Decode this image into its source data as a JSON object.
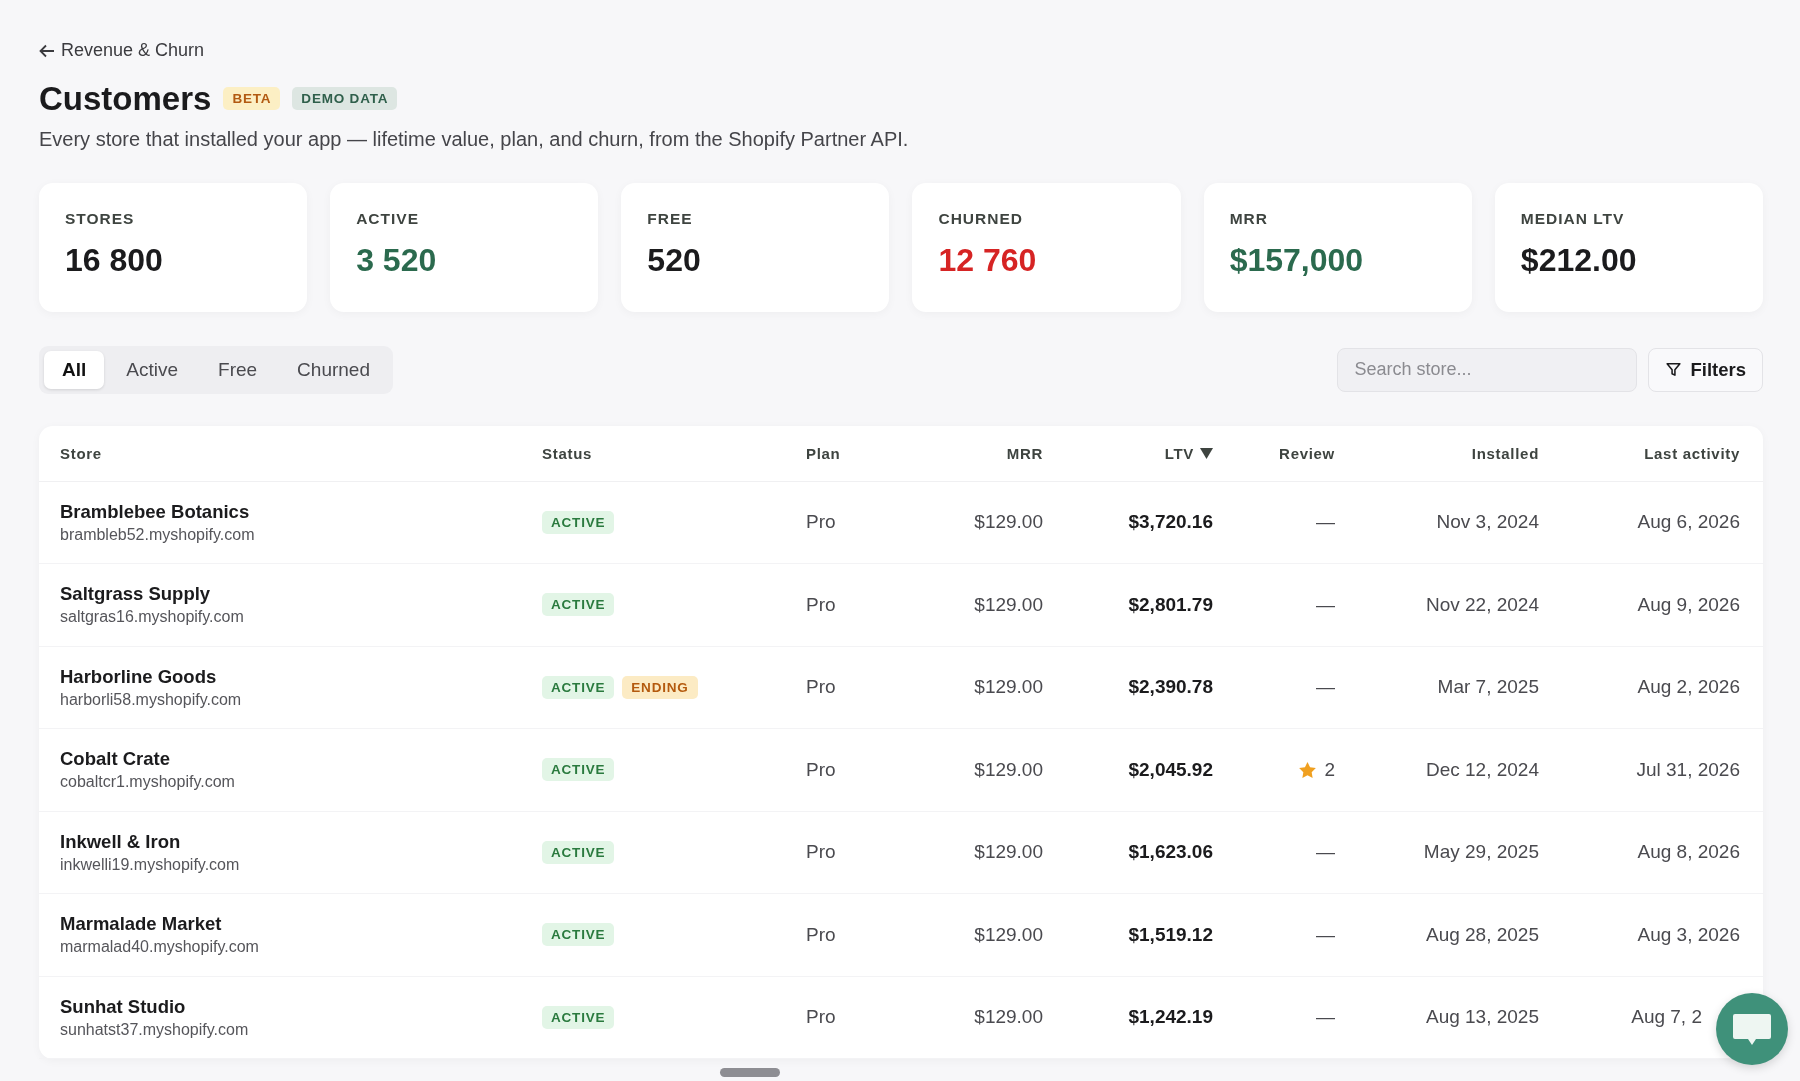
{
  "back_link": {
    "label": "Revenue & Churn"
  },
  "header": {
    "title": "Customers",
    "badges": [
      {
        "text": "BETA",
        "kind": "beta"
      },
      {
        "text": "DEMO DATA",
        "kind": "demo"
      }
    ],
    "subtitle": "Every store that installed your app — lifetime value, plan, and churn, from the Shopify Partner API."
  },
  "stats": [
    {
      "label": "STORES",
      "value": "16 800",
      "color": "#1b1b1d"
    },
    {
      "label": "ACTIVE",
      "value": "3 520",
      "color": "#2b6a4e"
    },
    {
      "label": "FREE",
      "value": "520",
      "color": "#1b1b1d"
    },
    {
      "label": "CHURNED",
      "value": "12 760",
      "color": "#d62424"
    },
    {
      "label": "MRR",
      "value": "$157,000",
      "color": "#2b6a4e"
    },
    {
      "label": "MEDIAN LTV",
      "value": "$212.00",
      "color": "#1b1b1d"
    }
  ],
  "tabs": [
    {
      "label": "All",
      "selected": true
    },
    {
      "label": "Active",
      "selected": false
    },
    {
      "label": "Free",
      "selected": false
    },
    {
      "label": "Churned",
      "selected": false
    }
  ],
  "search": {
    "placeholder": "Search store..."
  },
  "filters_button": {
    "label": "Filters"
  },
  "table": {
    "columns": [
      {
        "label": "Store",
        "sorted": false
      },
      {
        "label": "Status",
        "sorted": false
      },
      {
        "label": "Plan",
        "sorted": false
      },
      {
        "label": "MRR",
        "sorted": false
      },
      {
        "label": "LTV",
        "sorted": true
      },
      {
        "label": "Review",
        "sorted": false
      },
      {
        "label": "Installed",
        "sorted": false
      },
      {
        "label": "Last activity",
        "sorted": false
      }
    ],
    "rows": [
      {
        "name": "Bramblebee Botanics",
        "domain": "brambleb52.myshopify.com",
        "status": [
          {
            "text": "ACTIVE",
            "kind": "active"
          }
        ],
        "plan": "Pro",
        "mrr": "$129.00",
        "ltv": "$3,720.16",
        "review": {
          "kind": "none",
          "text": "—"
        },
        "installed": "Nov 3, 2024",
        "last_activity": "Aug 6, 2026"
      },
      {
        "name": "Saltgrass Supply",
        "domain": "saltgras16.myshopify.com",
        "status": [
          {
            "text": "ACTIVE",
            "kind": "active"
          }
        ],
        "plan": "Pro",
        "mrr": "$129.00",
        "ltv": "$2,801.79",
        "review": {
          "kind": "none",
          "text": "—"
        },
        "installed": "Nov 22, 2024",
        "last_activity": "Aug 9, 2026"
      },
      {
        "name": "Harborline Goods",
        "domain": "harborli58.myshopify.com",
        "status": [
          {
            "text": "ACTIVE",
            "kind": "active"
          },
          {
            "text": "ENDING",
            "kind": "ending"
          }
        ],
        "plan": "Pro",
        "mrr": "$129.00",
        "ltv": "$2,390.78",
        "review": {
          "kind": "none",
          "text": "—"
        },
        "installed": "Mar 7, 2025",
        "last_activity": "Aug 2, 2026"
      },
      {
        "name": "Cobalt Crate",
        "domain": "cobaltcr1.myshopify.com",
        "status": [
          {
            "text": "ACTIVE",
            "kind": "active"
          }
        ],
        "plan": "Pro",
        "mrr": "$129.00",
        "ltv": "$2,045.92",
        "review": {
          "kind": "rating",
          "text": "2"
        },
        "installed": "Dec 12, 2024",
        "last_activity": "Jul 31, 2026"
      },
      {
        "name": "Inkwell & Iron",
        "domain": "inkwelli19.myshopify.com",
        "status": [
          {
            "text": "ACTIVE",
            "kind": "active"
          }
        ],
        "plan": "Pro",
        "mrr": "$129.00",
        "ltv": "$1,623.06",
        "review": {
          "kind": "none",
          "text": "—"
        },
        "installed": "May 29, 2025",
        "last_activity": "Aug 8, 2026"
      },
      {
        "name": "Marmalade Market",
        "domain": "marmalad40.myshopify.com",
        "status": [
          {
            "text": "ACTIVE",
            "kind": "active"
          }
        ],
        "plan": "Pro",
        "mrr": "$129.00",
        "ltv": "$1,519.12",
        "review": {
          "kind": "none",
          "text": "—"
        },
        "installed": "Aug 28, 2025",
        "last_activity": "Aug 3, 2026"
      },
      {
        "name": "Sunhat Studio",
        "domain": "sunhatst37.myshopify.com",
        "status": [
          {
            "text": "ACTIVE",
            "kind": "active"
          }
        ],
        "plan": "Pro",
        "mrr": "$129.00",
        "ltv": "$1,242.19",
        "review": {
          "kind": "none",
          "text": "—"
        },
        "installed": "Aug 13, 2025",
        "last_activity": "Aug 7, 2"
      }
    ]
  }
}
